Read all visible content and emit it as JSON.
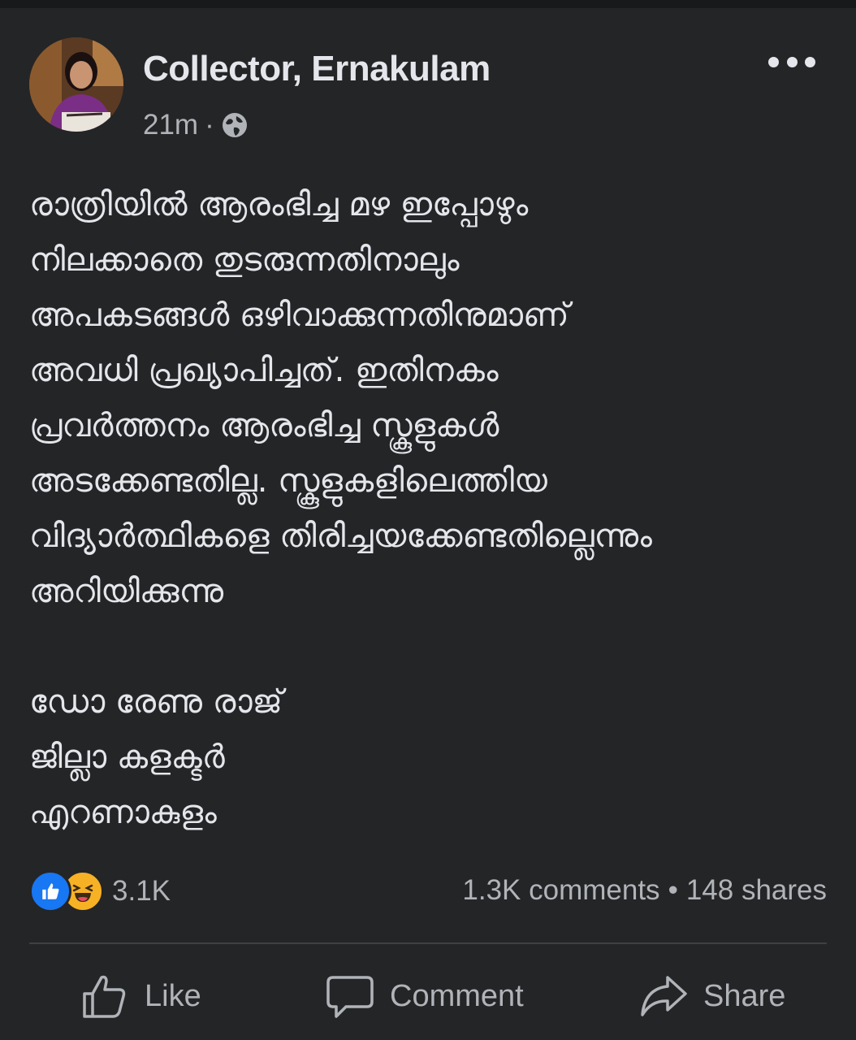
{
  "post": {
    "author": "Collector, Ernakulam",
    "time": "21m",
    "separator": "·",
    "privacy_icon": "globe-icon",
    "body_lines": [
      "രാത്രിയിൽ ആരംഭിച്ച മഴ ഇപ്പോഴും",
      "നിലക്കാതെ തുടരുന്നതിനാലും",
      "അപകടങ്ങൾ ഒഴിവാക്കുന്നതിനുമാണ്",
      "അവധി പ്രഖ്യാപിച്ചത്. ഇതിനകം",
      "പ്രവർത്തനം ആരംഭിച്ച സ്കൂളുകൾ",
      "അടക്കേണ്ടതില്ല. സ്കൂളുകളിലെത്തിയ",
      "വിദ്യാർത്ഥികളെ തിരിച്ചയക്കേണ്ടതില്ലെന്നും",
      "അറിയിക്കുന്നു"
    ],
    "signature_lines": [
      "ഡോ രേണു രാജ്",
      "ജില്ലാ കളക്ടർ",
      "എറണാകുളം"
    ]
  },
  "engagement": {
    "reaction_count": "3.1K",
    "comments": "1.3K comments",
    "bullet": "•",
    "shares": "148 shares"
  },
  "actions": {
    "like_label": "Like",
    "comment_label": "Comment",
    "share_label": "Share"
  },
  "colors": {
    "background": "#242526",
    "text": "#e4e6eb",
    "secondary_text": "#b0b3b8",
    "like_blue": "#1877f2",
    "haha_yellow": "#f7b125"
  }
}
